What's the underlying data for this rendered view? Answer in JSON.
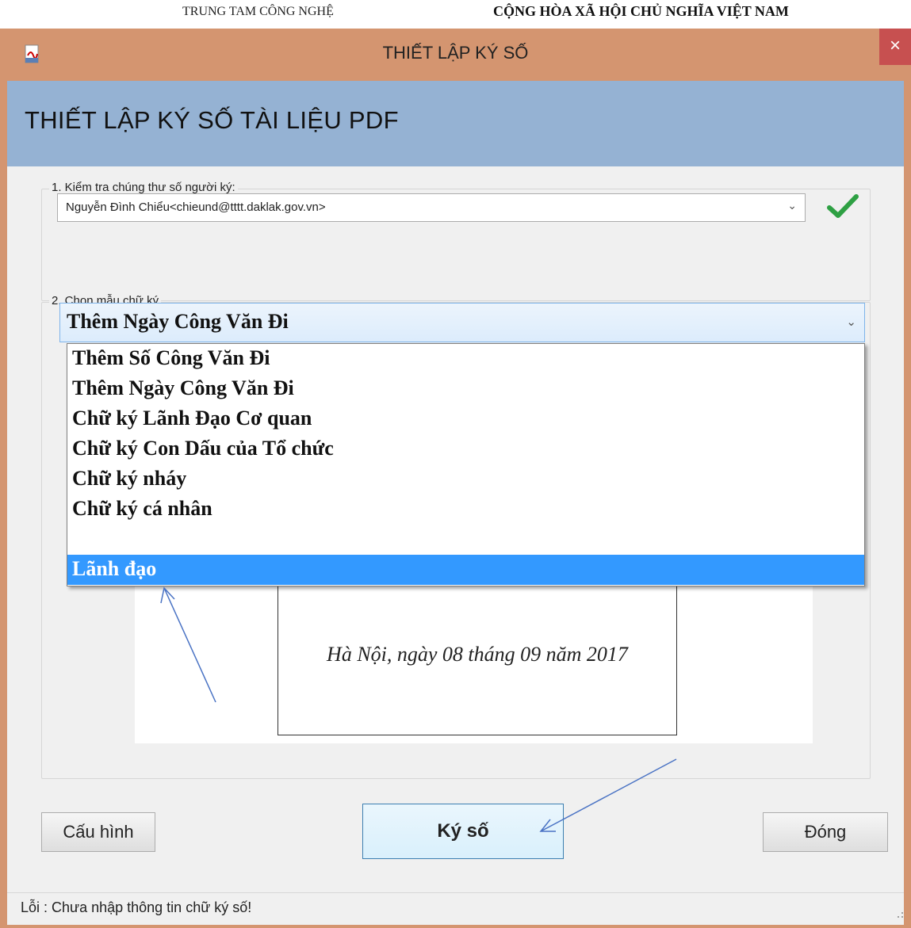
{
  "background_doc": {
    "left_header": "TRUNG TAM  CÔNG NGHỆ",
    "right_header": "CỘNG HÒA XÃ HỘI CHỦ NGHĨA VIỆT NAM"
  },
  "window": {
    "title": "THIẾT LẬP KÝ SỐ",
    "close_glyph": "×"
  },
  "banner": {
    "title": "THIẾT LẬP KÝ SỐ TÀI LIỆU PDF"
  },
  "certificate_group": {
    "label": "1. Kiểm tra chúng thư số người ký:",
    "selected_value": "Nguyễn Đình Chiểu<chieund@tttt.daklak.gov.vn>",
    "status_icon": "checkmark-icon",
    "status_color": "#2ea043"
  },
  "template_group": {
    "label": "2. Chọn mẫu chữ ký",
    "selected_value": "Thêm Ngày Công Văn Đi",
    "options": [
      "Thêm Số Công Văn Đi",
      "Thêm Ngày Công Văn Đi",
      "Chữ ký Lãnh Đạo Cơ quan",
      "Chữ ký Con Dấu của Tổ chức",
      "Chữ ký nháy",
      "Chữ ký cá nhân",
      "Lãnh đạo"
    ],
    "highlighted_option": "Lãnh đạo",
    "highlight_color": "#3399ff"
  },
  "preview": {
    "text": "Hà Nội, ngày 08 tháng 09 năm 2017"
  },
  "buttons": {
    "config": "Cấu hình",
    "sign": "Ký số",
    "close": "Đóng"
  },
  "status": {
    "message": "Lỗi : Chưa nhập thông tin chữ ký số!"
  },
  "annotations": {
    "arrow_color": "#4a73c4"
  }
}
